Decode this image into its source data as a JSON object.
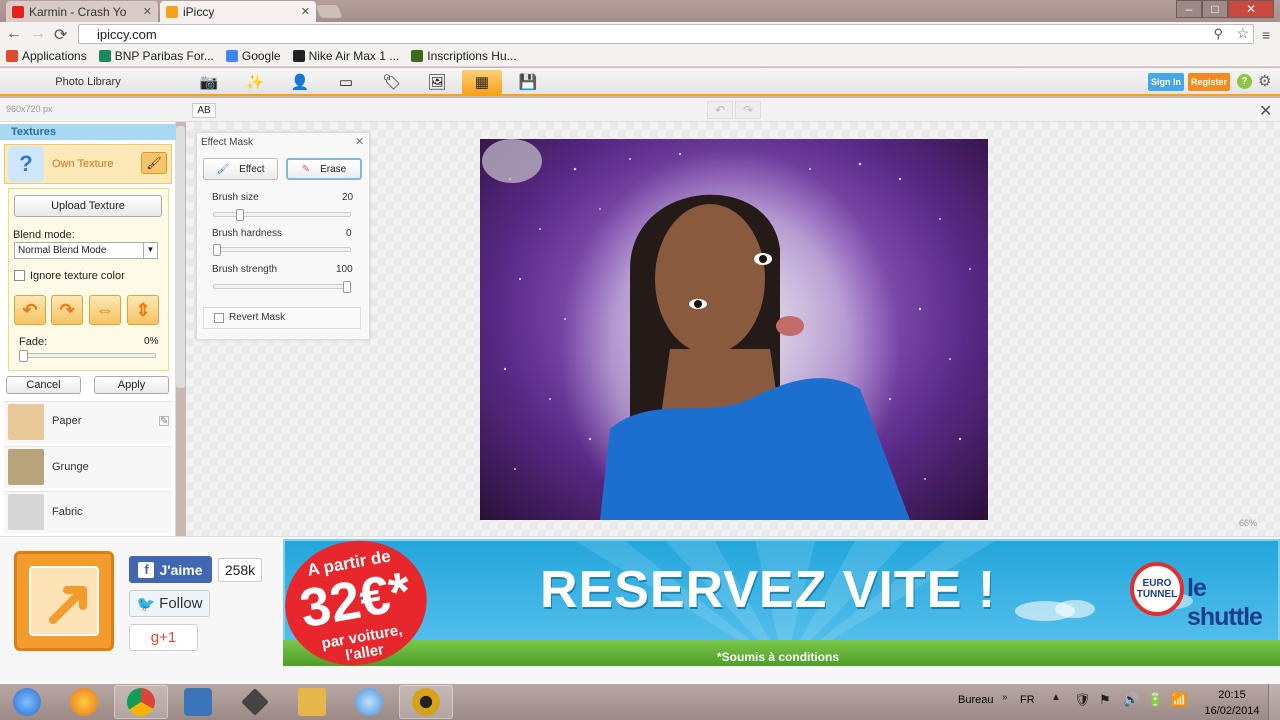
{
  "browser": {
    "tabs": [
      {
        "label": "Karmin - Crash Yo",
        "icon": "youtube-icon",
        "color": "#e62117"
      },
      {
        "label": "iPiccy",
        "icon": "ipiccy-icon",
        "color": "#f7a21b"
      }
    ],
    "window_controls": {
      "minimize": "–",
      "maximize": "□",
      "close": "✕"
    },
    "url": "ipiccy.com",
    "nav": {
      "back": "←",
      "forward": "→",
      "reload": "⟳"
    },
    "bookmarks": [
      {
        "label": "Applications",
        "icon": "apps-grid-icon",
        "color": "#e04a2f"
      },
      {
        "label": "BNP Paribas For...",
        "icon": "bnp-icon",
        "color": "#1a8a5a"
      },
      {
        "label": "Google",
        "icon": "google-icon",
        "color": "#4285f4"
      },
      {
        "label": "Nike Air Max 1 ...",
        "icon": "nike-icon",
        "color": "#222222"
      },
      {
        "label": "Inscriptions Hu...",
        "icon": "hu-icon",
        "color": "#3a6a1a"
      }
    ]
  },
  "app": {
    "photo_library": "Photo Library",
    "tools": [
      {
        "icon": "camera-icon",
        "glyph": "📷"
      },
      {
        "icon": "magic-wand-icon",
        "glyph": "✨"
      },
      {
        "icon": "portrait-icon",
        "glyph": "👤"
      },
      {
        "icon": "frame-icon",
        "glyph": "▭"
      },
      {
        "icon": "stamp-icon",
        "glyph": "🏷"
      },
      {
        "icon": "picture-icon",
        "glyph": "🖼"
      },
      {
        "icon": "textures-icon",
        "glyph": "▦"
      },
      {
        "icon": "save-icon",
        "glyph": "💾"
      }
    ],
    "sign_in": "Sign In",
    "register": "Register",
    "help": "?",
    "settings": "⚙",
    "dimensions": "960x720 px",
    "ab_icon": "AB",
    "undo": "↶",
    "redo": "↷",
    "close_editor": "✕",
    "zoom": "66%"
  },
  "textures": {
    "header": "Textures",
    "own_texture": "Own Texture",
    "own_texture_icon": "?",
    "brush": "🖌",
    "upload": "Upload Texture",
    "blend_label": "Blend mode:",
    "blend_value": "Normal Blend Mode",
    "ignore_color": "Ignore texture color",
    "arrows": [
      "↶",
      "↷",
      "⇔",
      "⇕"
    ],
    "fade_label": "Fade:",
    "fade_value": "0%",
    "fade": 0,
    "cancel": "Cancel",
    "apply": "Apply",
    "items": [
      {
        "label": "Paper",
        "color": "#e9c89a",
        "edit": "✎"
      },
      {
        "label": "Grunge",
        "color": "#b8a47a"
      },
      {
        "label": "Fabric",
        "color": "#d6d6d6"
      }
    ]
  },
  "effect_mask": {
    "title": "Effect Mask",
    "close": "✕",
    "effect": "Effect",
    "erase": "Erase",
    "sliders": [
      {
        "label": "Brush size",
        "value": "20",
        "fraction": 0.18
      },
      {
        "label": "Brush hardness",
        "value": "0",
        "fraction": 0.0
      },
      {
        "label": "Brush strength",
        "value": "100",
        "fraction": 1.0
      }
    ],
    "revert": "Revert Mask"
  },
  "social": {
    "like": "J'aime",
    "like_count": "258k",
    "follow": "Follow",
    "gplus": "g+1"
  },
  "ad": {
    "promo_line1": "A partir de",
    "promo_price": "32€*",
    "promo_line3": "par voiture,",
    "promo_line4": "l'aller",
    "headline": "RESERVEZ VITE !",
    "conditions": "*Soumis à conditions",
    "logo1_a": "EURO",
    "logo1_b": "TUNNEL",
    "logo2": "le shuttle"
  },
  "taskbar": {
    "apps": [
      {
        "icon": "windows-start-icon",
        "color": "#3a7ad8"
      },
      {
        "icon": "firefox-icon",
        "color": "#e8731c"
      },
      {
        "icon": "chrome-icon",
        "color": "#3aa757",
        "active": true
      },
      {
        "icon": "movie-maker-icon",
        "color": "#3b74b8"
      },
      {
        "icon": "rt-icon",
        "color": "#555555"
      },
      {
        "icon": "explorer-folder-icon",
        "color": "#e6b64a"
      },
      {
        "icon": "mail-icon",
        "color": "#4a90d6"
      },
      {
        "icon": "media-player-icon",
        "color": "#d6a21a"
      }
    ],
    "desktop": "Bureau",
    "lang": "FR",
    "tray": [
      "▲",
      "🛡",
      "⚑",
      "🔊",
      "🔋",
      "📶"
    ],
    "time": "20:15",
    "date": "16/02/2014"
  }
}
